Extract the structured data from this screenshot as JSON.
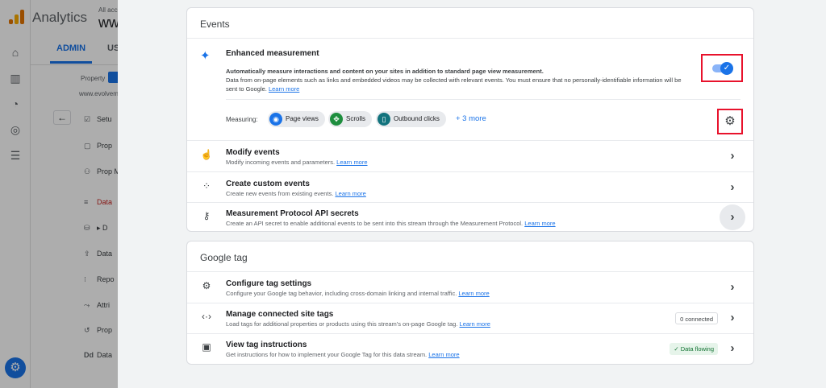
{
  "app": {
    "brand": "Analytics",
    "account_prefix": "All acc",
    "property_short": "ww",
    "tabs": [
      "ADMIN",
      "US"
    ],
    "property_label": "Property",
    "url_snippet": "www.evolvem",
    "menu": [
      {
        "label": "Setu",
        "icon": "checkbox-icon"
      },
      {
        "label": "Prop",
        "icon": "panel-icon"
      },
      {
        "label": "Prop Mana",
        "icon": "people-icon"
      },
      {
        "label": "Data",
        "icon": "stream-icon",
        "active": true
      },
      {
        "label": "▸ D",
        "icon": "database-icon"
      },
      {
        "label": "Data",
        "icon": "upload-icon"
      },
      {
        "label": "Repo",
        "icon": "report-icon"
      },
      {
        "label": "Attri",
        "icon": "attribution-icon"
      },
      {
        "label": "Prop",
        "icon": "history-icon"
      },
      {
        "label": "Data",
        "icon": "dd-icon"
      }
    ]
  },
  "events_card": {
    "title": "Events",
    "enhanced": {
      "title": "Enhanced measurement",
      "description": "Automatically measure interactions and content on your sites in addition to standard page view measurement.",
      "note": "Data from on-page elements such as links and embedded videos may be collected with relevant events. You must ensure that no personally-identifiable information will be sent to Google.",
      "learn_more": "Learn more",
      "enabled": true,
      "measuring_label": "Measuring:",
      "chips": [
        "Page views",
        "Scrolls",
        "Outbound clicks"
      ],
      "more": "+ 3 more"
    },
    "rows": [
      {
        "title": "Modify events",
        "desc": "Modify incoming events and parameters.",
        "link": "Learn more"
      },
      {
        "title": "Create custom events",
        "desc": "Create new events from existing events.",
        "link": "Learn more"
      },
      {
        "title": "Measurement Protocol API secrets",
        "desc": "Create an API secret to enable additional events to be sent into this stream through the Measurement Protocol.",
        "link": "Learn more"
      }
    ]
  },
  "gtag_card": {
    "title": "Google tag",
    "rows": [
      {
        "title": "Configure tag settings",
        "desc": "Configure your Google tag behavior, including cross-domain linking and internal traffic.",
        "link": "Learn more"
      },
      {
        "title": "Manage connected site tags",
        "desc": "Load tags for additional properties or products using this stream's on-page Google tag.",
        "link": "Learn more",
        "badge": "0 connected"
      },
      {
        "title": "View tag instructions",
        "desc": "Get instructions for how to implement your Google Tag for this data stream.",
        "link": "Learn more",
        "badge": "Data flowing"
      }
    ]
  },
  "colors": {
    "accent": "#1a73e8",
    "highlight": "#e8122c",
    "success": "#137333"
  }
}
